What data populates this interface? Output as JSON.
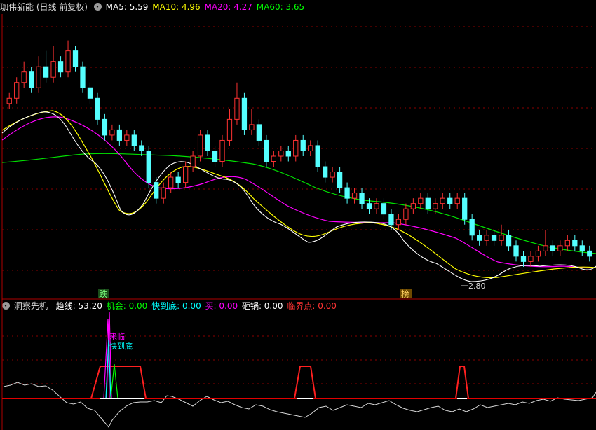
{
  "main_panel": {
    "title": "珈伟新能 (日线 前复权)",
    "legend": [
      {
        "label": "MA5: 5.59",
        "color": "#ffffff"
      },
      {
        "label": "MA10: 4.96",
        "color": "#ffff00"
      },
      {
        "label": "MA20: 4.27",
        "color": "#ff00ff"
      },
      {
        "label": "MA60: 3.65",
        "color": "#00ff00"
      }
    ],
    "price_range": [
      2.2,
      7.6
    ],
    "low_marker": "2.80",
    "tag_left": "跌",
    "tag_right": "榜"
  },
  "sub_panel": {
    "title": "洞察先机",
    "legend": [
      {
        "label": "趋线: 53.20",
        "color": "#ffffff"
      },
      {
        "label": "机会: 0.00",
        "color": "#00ff00"
      },
      {
        "label": "快到底: 0.00",
        "color": "#00ffff"
      },
      {
        "label": "买: 0.00",
        "color": "#ff00ff"
      },
      {
        "label": "砸锅: 0.00",
        "color": "#ffffff"
      },
      {
        "label": "临界点: 0.00",
        "color": "#ff3333"
      }
    ],
    "annotation_1": "来临",
    "annotation_2": "快到底"
  },
  "chart_data": {
    "type": "candlestick",
    "series_meta": [
      {
        "name": "MA5",
        "color": "#ffffff"
      },
      {
        "name": "MA10",
        "color": "#ffff00"
      },
      {
        "name": "MA20",
        "color": "#ff00ff"
      },
      {
        "name": "MA60",
        "color": "#00ff00"
      }
    ],
    "candles": [
      [
        5.9,
        6.0,
        5.8,
        6.1
      ],
      [
        6.0,
        6.3,
        5.9,
        6.4
      ],
      [
        6.3,
        6.5,
        6.2,
        6.7
      ],
      [
        6.5,
        6.2,
        6.1,
        6.6
      ],
      [
        6.2,
        6.6,
        6.1,
        6.8
      ],
      [
        6.6,
        6.4,
        6.3,
        6.9
      ],
      [
        6.4,
        6.7,
        6.3,
        7.0
      ],
      [
        6.7,
        6.5,
        6.4,
        6.8
      ],
      [
        6.5,
        6.9,
        6.4,
        7.1
      ],
      [
        6.9,
        6.6,
        6.5,
        7.0
      ],
      [
        6.6,
        6.2,
        6.1,
        6.7
      ],
      [
        6.2,
        6.0,
        5.9,
        6.3
      ],
      [
        6.0,
        5.6,
        5.5,
        6.1
      ],
      [
        5.6,
        5.3,
        5.2,
        5.7
      ],
      [
        5.3,
        5.4,
        5.2,
        5.5
      ],
      [
        5.4,
        5.2,
        5.1,
        5.5
      ],
      [
        5.2,
        5.3,
        5.1,
        5.4
      ],
      [
        5.3,
        5.1,
        5.0,
        5.4
      ],
      [
        5.1,
        5.0,
        4.9,
        5.2
      ],
      [
        5.0,
        4.4,
        4.3,
        5.1
      ],
      [
        4.4,
        4.1,
        4.0,
        4.5
      ],
      [
        4.1,
        4.3,
        4.0,
        4.4
      ],
      [
        4.3,
        4.5,
        4.2,
        4.6
      ],
      [
        4.5,
        4.4,
        4.3,
        4.6
      ],
      [
        4.4,
        4.7,
        4.3,
        4.8
      ],
      [
        4.7,
        4.9,
        4.6,
        5.0
      ],
      [
        4.9,
        5.3,
        4.8,
        5.4
      ],
      [
        5.3,
        5.0,
        4.9,
        5.4
      ],
      [
        5.0,
        4.8,
        4.7,
        5.1
      ],
      [
        4.8,
        5.2,
        4.7,
        5.3
      ],
      [
        5.2,
        5.6,
        5.1,
        5.8
      ],
      [
        5.6,
        6.0,
        5.5,
        6.3
      ],
      [
        6.0,
        5.4,
        5.3,
        6.1
      ],
      [
        5.4,
        5.5,
        5.3,
        5.8
      ],
      [
        5.5,
        5.2,
        5.1,
        5.6
      ],
      [
        5.2,
        4.8,
        4.7,
        5.3
      ],
      [
        4.8,
        4.9,
        4.7,
        5.0
      ],
      [
        4.9,
        5.0,
        4.8,
        5.1
      ],
      [
        5.0,
        4.9,
        4.8,
        5.1
      ],
      [
        4.9,
        5.2,
        4.8,
        5.3
      ],
      [
        5.2,
        5.0,
        4.9,
        5.3
      ],
      [
        5.0,
        5.1,
        4.9,
        5.2
      ],
      [
        5.1,
        4.7,
        4.6,
        5.2
      ],
      [
        4.7,
        4.5,
        4.4,
        4.8
      ],
      [
        4.5,
        4.6,
        4.4,
        4.7
      ],
      [
        4.6,
        4.3,
        4.2,
        4.7
      ],
      [
        4.3,
        4.1,
        4.0,
        4.4
      ],
      [
        4.1,
        4.2,
        4.0,
        4.3
      ],
      [
        4.2,
        4.0,
        3.9,
        4.3
      ],
      [
        4.0,
        3.9,
        3.8,
        4.1
      ],
      [
        3.9,
        4.0,
        3.8,
        4.1
      ],
      [
        4.0,
        3.8,
        3.7,
        4.1
      ],
      [
        3.8,
        3.6,
        3.5,
        3.9
      ],
      [
        3.6,
        3.7,
        3.5,
        3.8
      ],
      [
        3.7,
        3.9,
        3.6,
        4.0
      ],
      [
        3.9,
        4.0,
        3.8,
        4.1
      ],
      [
        4.0,
        4.1,
        3.9,
        4.2
      ],
      [
        4.1,
        3.9,
        3.8,
        4.2
      ],
      [
        3.9,
        4.0,
        3.8,
        4.1
      ],
      [
        4.0,
        4.1,
        3.9,
        4.2
      ],
      [
        4.1,
        4.0,
        3.9,
        4.2
      ],
      [
        4.0,
        4.1,
        3.9,
        4.2
      ],
      [
        4.1,
        3.7,
        3.6,
        4.2
      ],
      [
        3.7,
        3.4,
        3.3,
        3.8
      ],
      [
        3.4,
        3.3,
        3.2,
        3.5
      ],
      [
        3.3,
        3.4,
        3.2,
        3.5
      ],
      [
        3.4,
        3.3,
        3.2,
        3.5
      ],
      [
        3.3,
        3.4,
        3.2,
        3.6
      ],
      [
        3.4,
        3.2,
        3.1,
        3.5
      ],
      [
        3.2,
        3.0,
        2.9,
        3.3
      ],
      [
        3.0,
        2.9,
        2.8,
        3.1
      ],
      [
        2.9,
        3.0,
        2.8,
        3.1
      ],
      [
        3.0,
        3.1,
        2.9,
        3.2
      ],
      [
        3.1,
        3.2,
        3.0,
        3.5
      ],
      [
        3.2,
        3.1,
        3.0,
        3.3
      ],
      [
        3.1,
        3.2,
        3.0,
        3.3
      ],
      [
        3.2,
        3.3,
        3.1,
        3.4
      ],
      [
        3.3,
        3.2,
        3.1,
        3.4
      ],
      [
        3.2,
        3.1,
        3.0,
        3.3
      ],
      [
        3.1,
        3.0,
        2.9,
        3.2
      ]
    ]
  }
}
